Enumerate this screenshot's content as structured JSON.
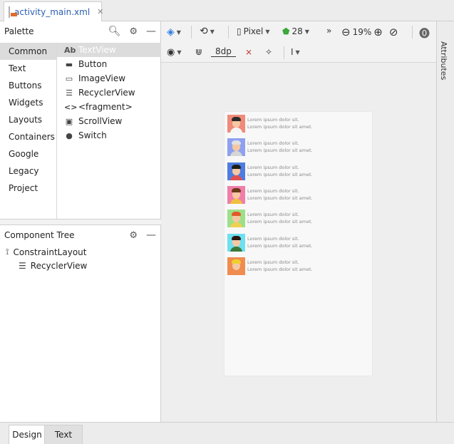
{
  "file_tab": {
    "name": "activity_main.xml",
    "close": "✕"
  },
  "palette": {
    "title": "Palette",
    "categories": [
      "Common",
      "Text",
      "Buttons",
      "Widgets",
      "Layouts",
      "Containers",
      "Google",
      "Legacy",
      "Project"
    ],
    "selected_category": "Common",
    "items": [
      {
        "icon": "Ab",
        "label": "TextView"
      },
      {
        "icon": "▬",
        "label": "Button"
      },
      {
        "icon": "▭",
        "label": "ImageView"
      },
      {
        "icon": "☰",
        "label": "RecyclerView"
      },
      {
        "icon": "<>",
        "label": "<fragment>"
      },
      {
        "icon": "▣",
        "label": "ScrollView"
      },
      {
        "icon": "●",
        "label": "Switch"
      }
    ]
  },
  "component_tree": {
    "title": "Component Tree",
    "root": "ConstraintLayout",
    "child": "RecyclerView"
  },
  "toolbar": {
    "device": "Pixel",
    "api": "28",
    "more": "»",
    "zoom": "19%",
    "margin": "8dp"
  },
  "list_rows": [
    {
      "line1": "Lorem ipsum dolor sit.",
      "line2": "Lorem ipsum dolor sit amet.",
      "bg": "#f08a7a",
      "hair": "#2b2b2b",
      "body": "#f5f5f5"
    },
    {
      "line1": "Lorem ipsum dolor sit.",
      "line2": "Lorem ipsum dolor sit amet.",
      "bg": "#8ea0f0",
      "hair": "#e0e0e0",
      "body": "#d6d6d6"
    },
    {
      "line1": "Lorem ipsum dolor sit.",
      "line2": "Lorem ipsum dolor sit amet.",
      "bg": "#4f7ce0",
      "hair": "#1e1e1e",
      "body": "#e05050"
    },
    {
      "line1": "Lorem ipsum dolor sit.",
      "line2": "Lorem ipsum dolor sit amet.",
      "bg": "#f07ea8",
      "hair": "#6a3a1a",
      "body": "#f0c040"
    },
    {
      "line1": "Lorem ipsum dolor sit.",
      "line2": "Lorem ipsum dolor sit amet.",
      "bg": "#9ee08a",
      "hair": "#e05a2a",
      "body": "#f0d050"
    },
    {
      "line1": "Lorem ipsum dolor sit.",
      "line2": "Lorem ipsum dolor sit amet.",
      "bg": "#6ee0f0",
      "hair": "#2a1a10",
      "body": "#3a7a3a"
    },
    {
      "line1": "Lorem ipsum dolor sit.",
      "line2": "Lorem ipsum dolor sit amet.",
      "bg": "#f08c50",
      "hair": "#f0d030",
      "body": "#f08c50"
    }
  ],
  "right_panel": {
    "label": "Attributes"
  },
  "bottom_tabs": {
    "design": "Design",
    "text": "Text"
  }
}
